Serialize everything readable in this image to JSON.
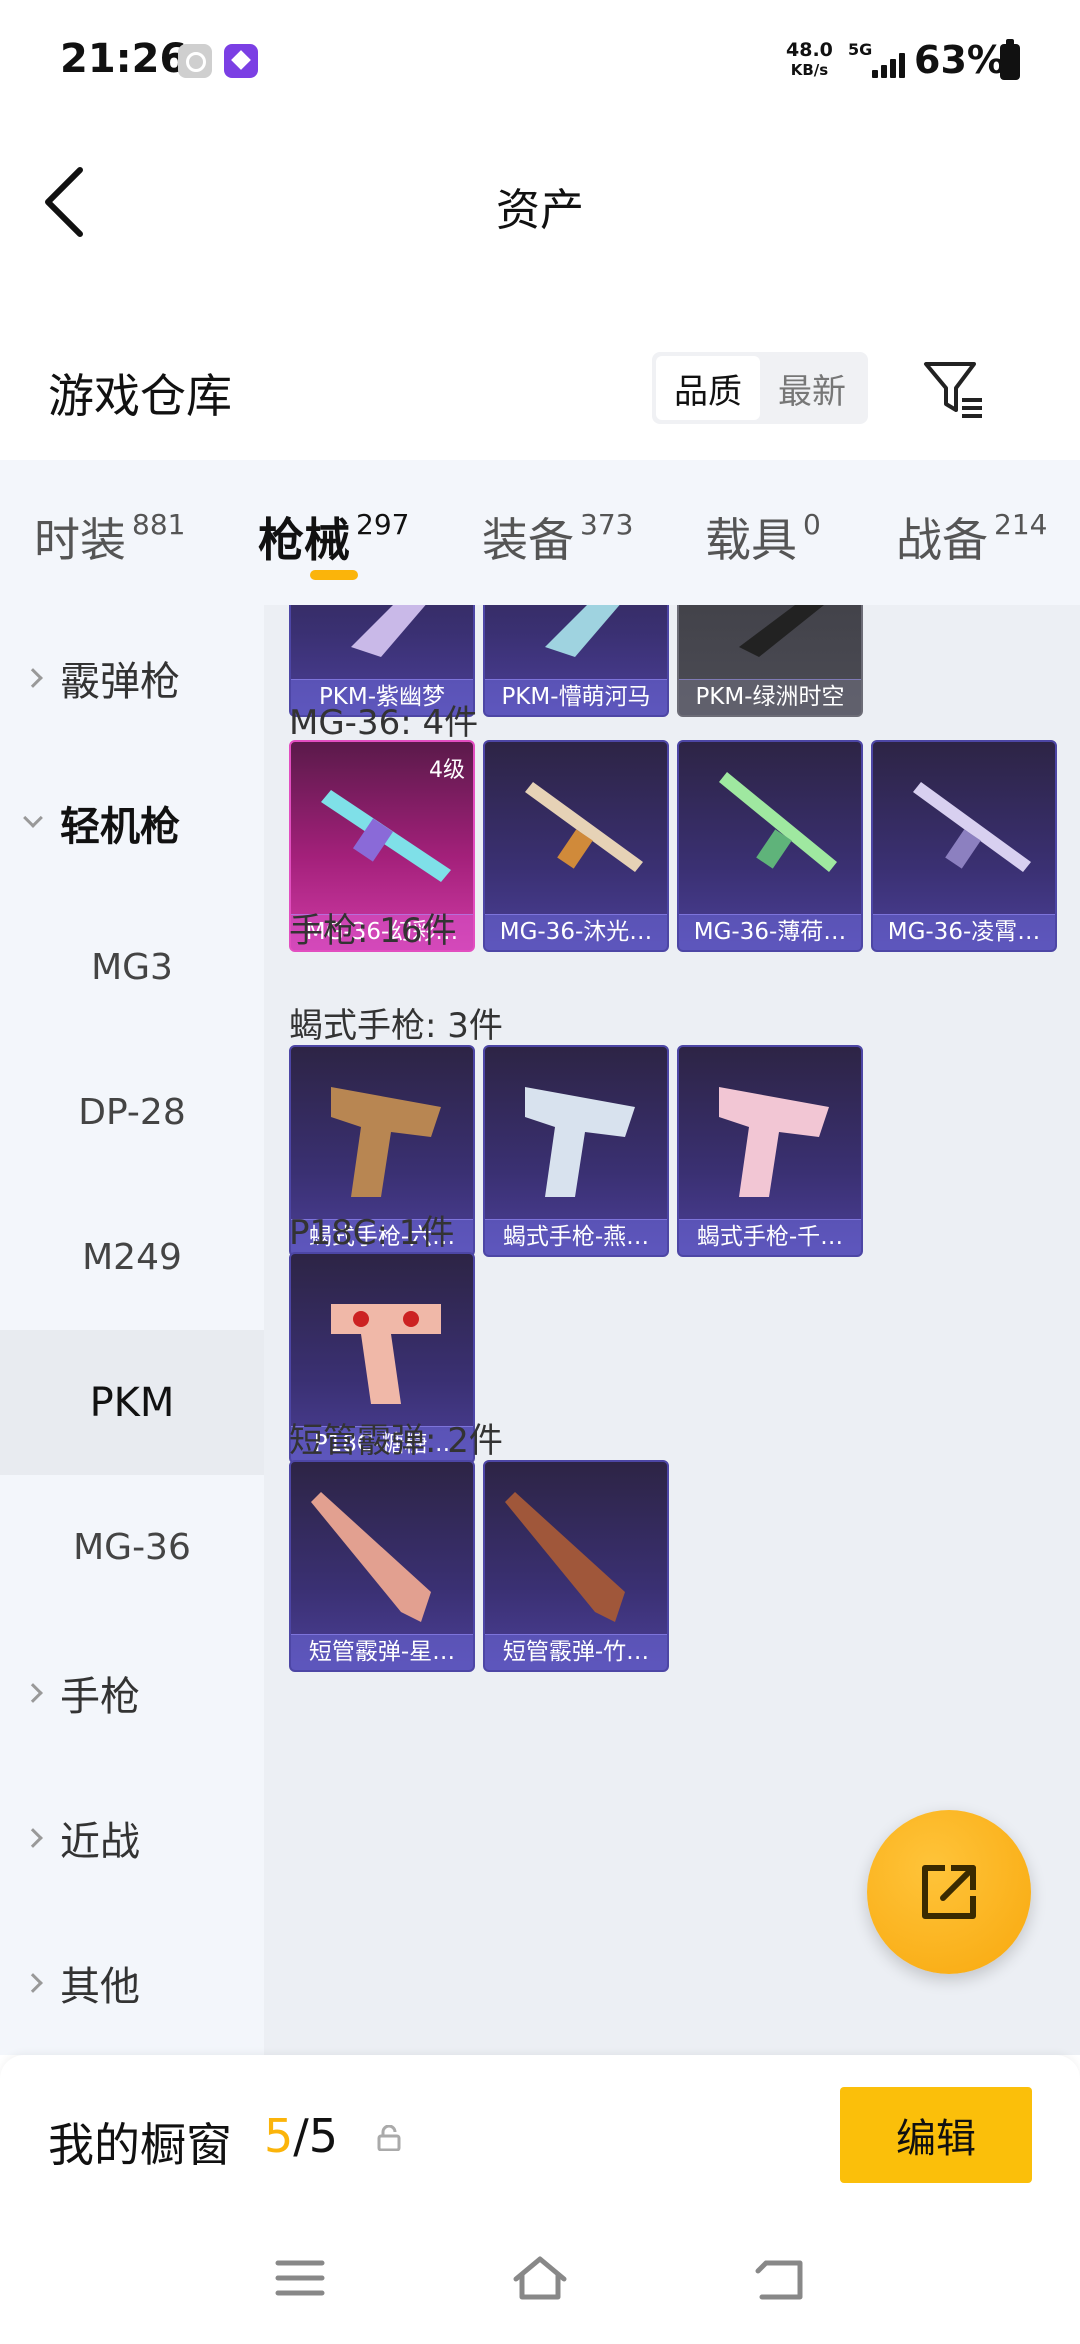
{
  "status": {
    "time": "21:26",
    "speed_top": "48.0",
    "speed_unit": "KB/s",
    "network": "5G",
    "battery": "63%"
  },
  "header": {
    "title": "资产",
    "back_icon": "chevron-left-icon"
  },
  "subheader": {
    "title": "游戏仓库",
    "sort_options": [
      "品质",
      "最新"
    ],
    "sort_selected": "品质",
    "filter_icon": "filter-icon"
  },
  "tabs": [
    {
      "label": "时装",
      "count": "881"
    },
    {
      "label": "枪械",
      "count": "297"
    },
    {
      "label": "装备",
      "count": "373"
    },
    {
      "label": "载具",
      "count": "0"
    },
    {
      "label": "战备",
      "count": "214"
    }
  ],
  "active_tab": "枪械",
  "categories": {
    "shotgun": "霰弹枪",
    "lmg": "轻机枪",
    "mg3": "MG3",
    "dp28": "DP-28",
    "m249": "M249",
    "pkm": "PKM",
    "mg36": "MG-36",
    "pistol": "手枪",
    "melee": "近战",
    "other": "其他"
  },
  "content": {
    "pkm_cards": [
      "PKM-紫幽梦",
      "PKM-懵萌河马",
      "PKM-绿洲时空"
    ],
    "mg36_title": "MG-36: 4件",
    "mg36_cards": [
      "MG-36-幻彩…",
      "MG-36-沐光…",
      "MG-36-薄荷…",
      "MG-36-凌霄…"
    ],
    "mg36_level": "4级",
    "pistol_title": "手枪: 16件",
    "scorpion_title": "蝎式手枪: 3件",
    "scorpion_cards": [
      "蝎式手枪-六…",
      "蝎式手枪-燕…",
      "蝎式手枪-千…"
    ],
    "p18c_title": "P18C: 1件",
    "p18c_cards": [
      "P18C-糖糖…"
    ],
    "sawed_title": "短管霰弹: 2件",
    "sawed_cards": [
      "短管霰弹-星…",
      "短管霰弹-竹…"
    ]
  },
  "bottom": {
    "showcase_label": "我的橱窗",
    "showcase_current": "5",
    "showcase_total": "/5",
    "edit_label": "编辑"
  },
  "colors": {
    "accent": "#fbb40a",
    "card_purple": "#3a3072",
    "card_gold": "#d03ba6"
  }
}
